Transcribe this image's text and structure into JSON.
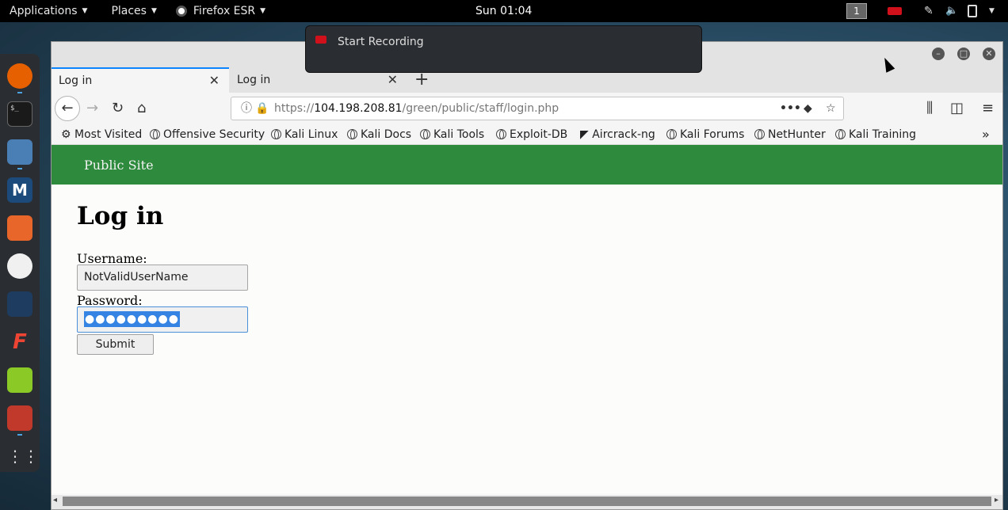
{
  "top_panel": {
    "applications": "Applications",
    "places": "Places",
    "firefox": "Firefox ESR",
    "clock": "Sun 01:04",
    "workspace": "1"
  },
  "notification": {
    "text": "Start Recording"
  },
  "tabs": [
    {
      "label": "Log in",
      "close": "✕"
    },
    {
      "label": "Log in",
      "close": "✕"
    }
  ],
  "new_tab": "+",
  "url": {
    "prefix": "https://",
    "host": "104.198.208.81",
    "path": "/green/public/staff/login.php"
  },
  "bookmarks": [
    {
      "label": "Most Visited",
      "icon": "gear-icon"
    },
    {
      "label": "Offensive Security",
      "icon": "globe-icon"
    },
    {
      "label": "Kali Linux",
      "icon": "globe-icon"
    },
    {
      "label": "Kali Docs",
      "icon": "globe-icon"
    },
    {
      "label": "Kali Tools",
      "icon": "globe-icon"
    },
    {
      "label": "Exploit-DB",
      "icon": "globe-icon"
    },
    {
      "label": "Aircrack-ng",
      "icon": "aircrack-icon"
    },
    {
      "label": "Kali Forums",
      "icon": "globe-icon"
    },
    {
      "label": "NetHunter",
      "icon": "globe-icon"
    },
    {
      "label": "Kali Training",
      "icon": "globe-icon"
    }
  ],
  "page": {
    "site_link": "Public Site",
    "title": "Log in",
    "username_label": "Username:",
    "username_value": "NotValidUserName",
    "password_label": "Password:",
    "password_value": "●●●●●●●●●",
    "submit": "Submit"
  },
  "colors": {
    "header_green": "#2e8b3d",
    "selection_blue": "#3584e4",
    "tab_accent": "#0a84ff"
  }
}
